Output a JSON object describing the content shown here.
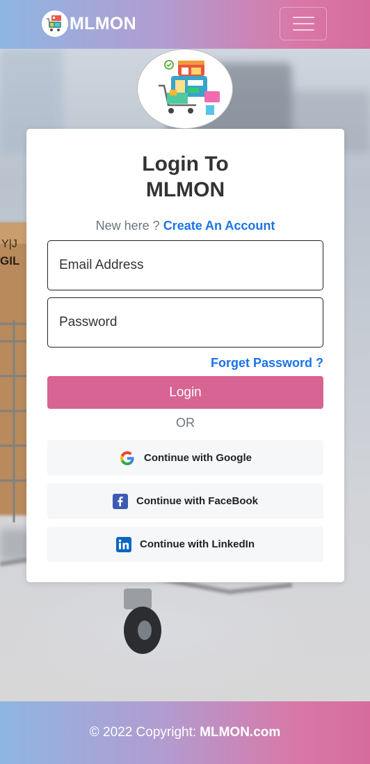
{
  "header": {
    "brand": "MLMON",
    "menu_icon": "hamburger-menu-icon"
  },
  "card": {
    "title_line1": "Login To",
    "title_line2": "MLMON",
    "new_here": "New here ?",
    "create_account": "Create An Account",
    "email_placeholder": "Email Address",
    "password_placeholder": "Password",
    "forgot_password": "Forget Password ?",
    "login_button": "Login",
    "or_text": "OR",
    "social": [
      {
        "label": "Continue with Google",
        "icon": "google-icon"
      },
      {
        "label": "Continue with FaceBook",
        "icon": "facebook-icon"
      },
      {
        "label": "Continue with LinkedIn",
        "icon": "linkedin-icon"
      }
    ]
  },
  "footer": {
    "copyright": "© 2022 Copyright:",
    "site": "MLMON.com"
  },
  "colors": {
    "accent": "#d76492",
    "link": "#1b73e8",
    "gradient_start": "#8fb6e3",
    "gradient_end": "#d66c9d"
  }
}
